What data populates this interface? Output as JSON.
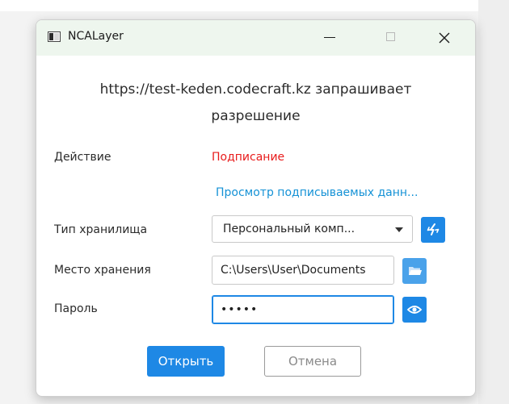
{
  "window": {
    "title": "NCALayer"
  },
  "dialog": {
    "heading_line1": "https://test-keden.codecraft.kz запрашивает",
    "heading_line2": "разрешение",
    "action_label": "Действие",
    "action_value": "Подписание",
    "view_data_link": "Просмотр подписываемых данн...",
    "storage_type_label": "Тип хранилища",
    "storage_type_value": "Персональный комп...",
    "location_label": "Место хранения",
    "location_value": "C:\\Users\\User\\Documents",
    "password_label": "Пароль",
    "password_value": "•••••",
    "open_button": "Открыть",
    "cancel_button": "Отмена"
  },
  "icons": {
    "app": "ncalayer-app-icon",
    "minimize": "minimize-icon",
    "maximize": "maximize-icon",
    "close": "close-icon",
    "refresh": "refresh-icon",
    "folder": "folder-icon",
    "eye": "eye-icon",
    "dropdown": "chevron-down-icon"
  },
  "colors": {
    "accent": "#1e88e5",
    "link": "#1592d6",
    "danger": "#e81b1b",
    "titlebar": "#eef6ee"
  }
}
